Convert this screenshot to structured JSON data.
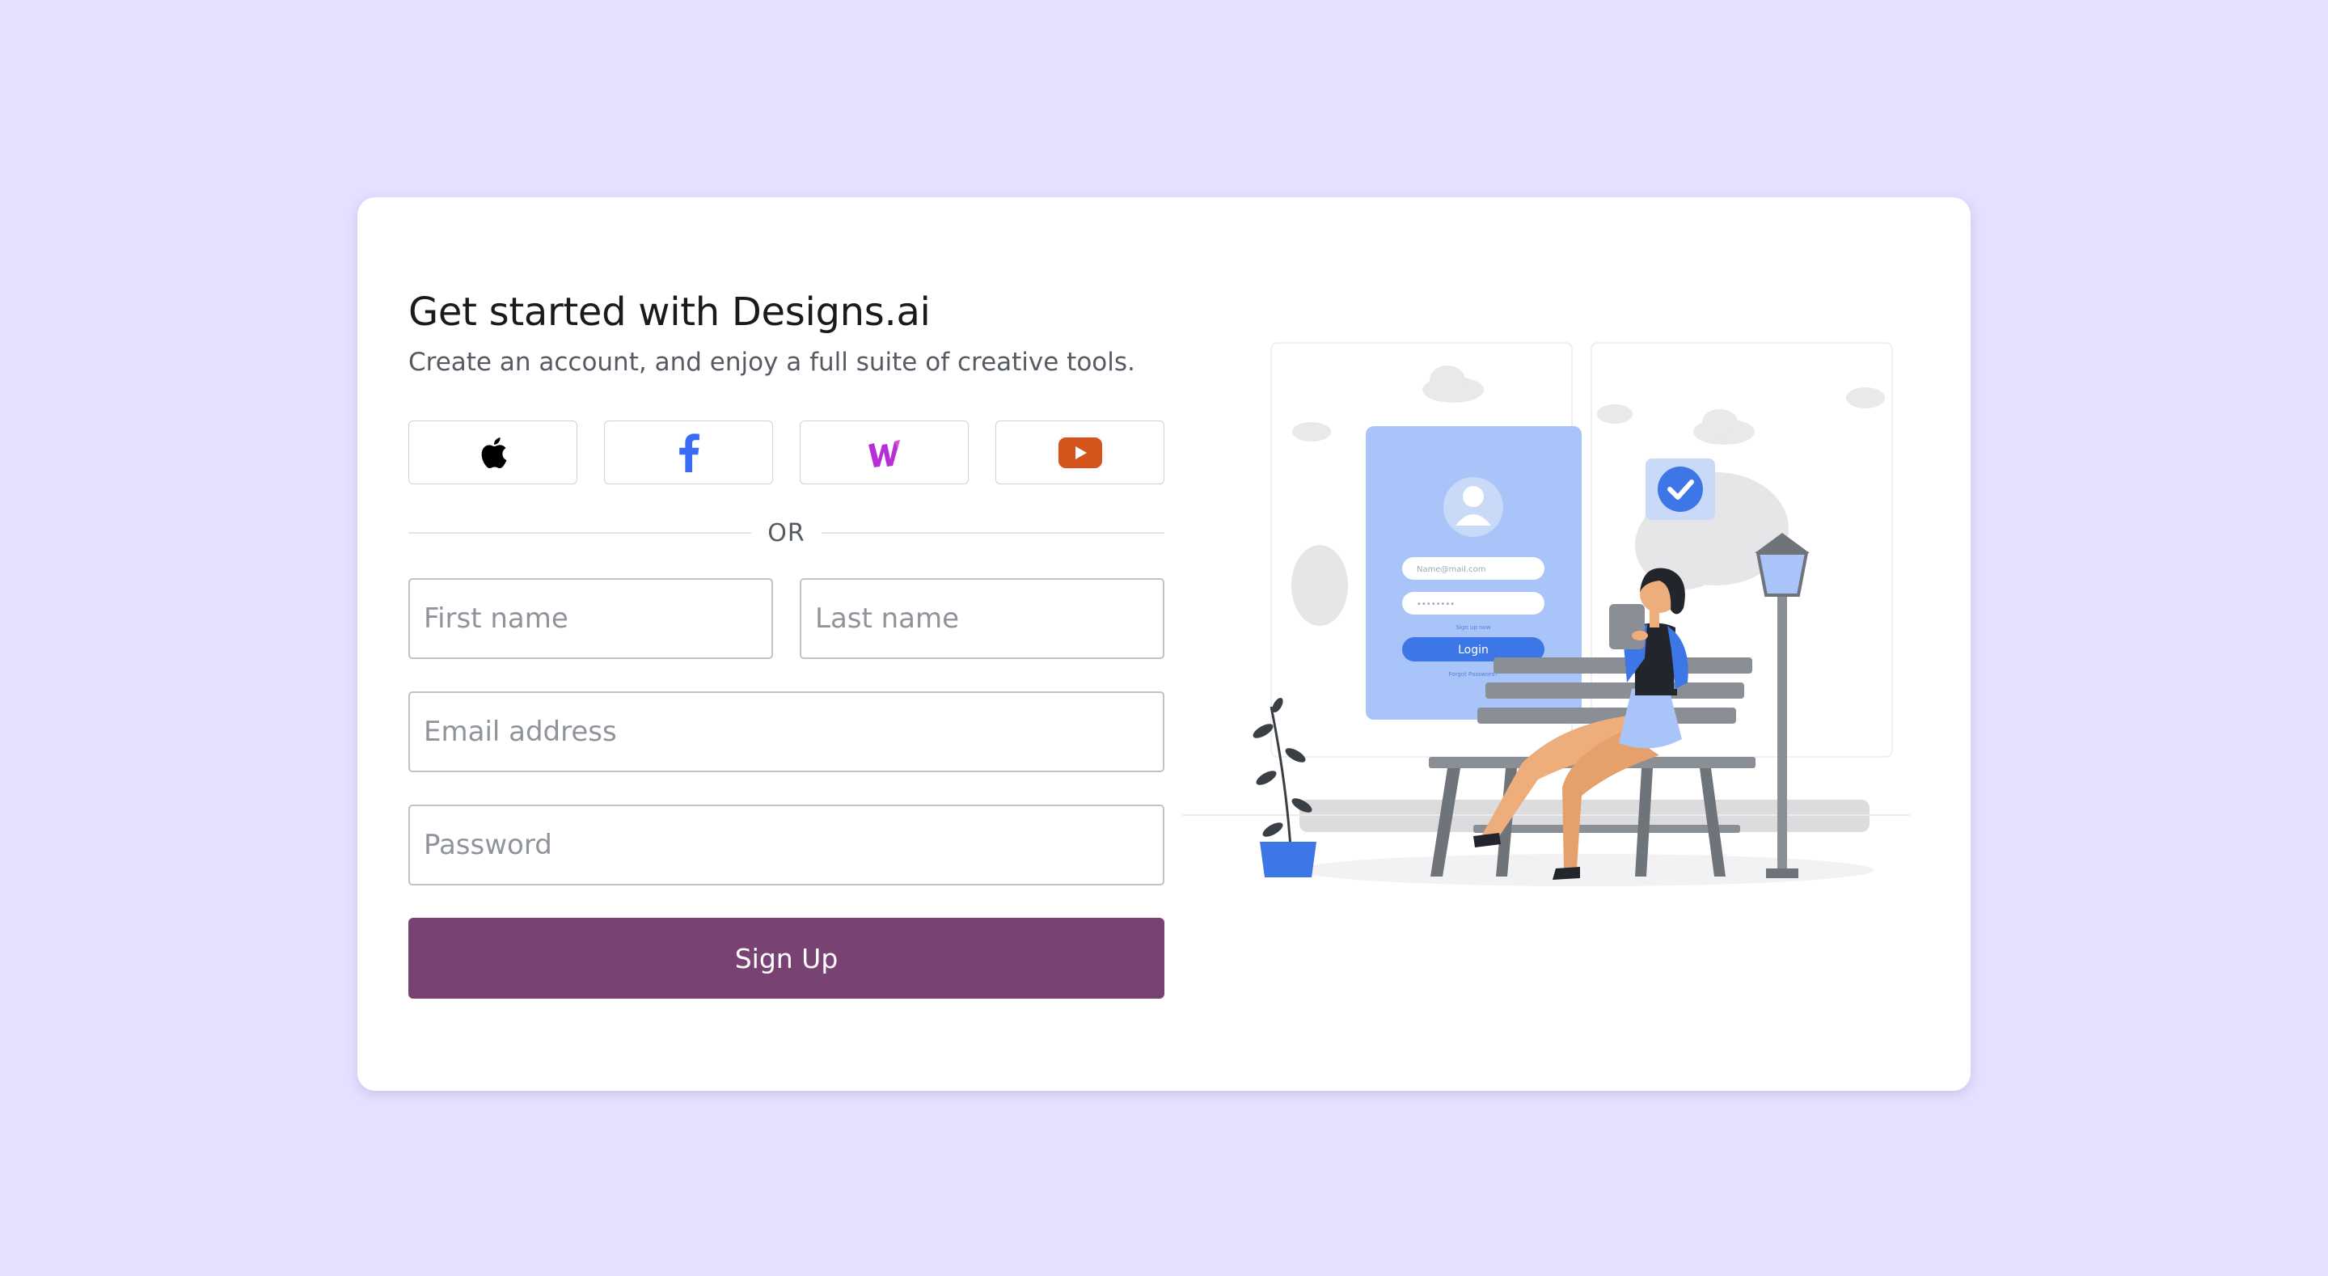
{
  "header": {
    "title": "Get started with Designs.ai",
    "subtitle": "Create an account, and enjoy a full suite of creative tools."
  },
  "social": [
    {
      "name": "apple",
      "icon": "apple-icon"
    },
    {
      "name": "facebook",
      "icon": "facebook-icon"
    },
    {
      "name": "wix",
      "icon": "w-logo-icon"
    },
    {
      "name": "youtube",
      "icon": "youtube-icon"
    }
  ],
  "divider": {
    "label": "OR"
  },
  "form": {
    "first_name_placeholder": "First name",
    "last_name_placeholder": "Last name",
    "email_placeholder": "Email address",
    "password_placeholder": "Password",
    "submit_label": "Sign Up"
  },
  "illustration": {
    "email_placeholder": "Name@mail.com",
    "password_mask": "••••••••",
    "signup_link": "Sign up now",
    "login_label": "Login",
    "forgot_link": "Forgot Password?"
  },
  "colors": {
    "background": "#e4e0fe",
    "card": "#ffffff",
    "primary_button": "#784272",
    "facebook": "#3b6cf5",
    "youtube": "#d4541c",
    "w_logo": "#b72ed9",
    "illustration_blue": "#a9c4f8",
    "illustration_accent": "#3d76e6"
  }
}
